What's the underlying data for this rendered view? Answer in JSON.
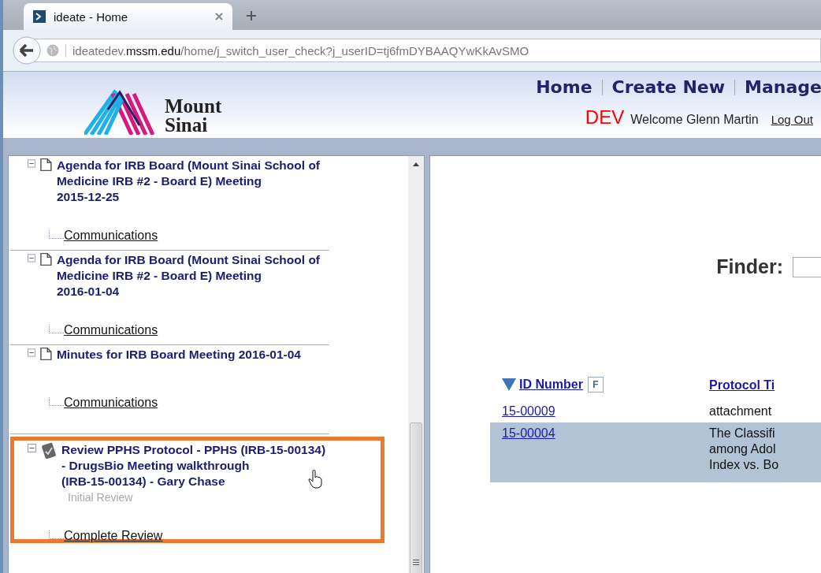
{
  "browser": {
    "tab": {
      "title": "ideate - Home",
      "selected": true
    },
    "url": {
      "prefix": "ideatedev.",
      "host": "mssm.edu",
      "path": "/home/j_switch_user_check?j_userID=tj6fmDYBAAQYwKkAvSMO"
    }
  },
  "header": {
    "logo": {
      "line1": "Mount",
      "line2": "Sinai"
    },
    "nav": [
      {
        "label": "Home"
      },
      {
        "label": "Create New"
      },
      {
        "label": "Manage"
      }
    ],
    "environment": "DEV",
    "welcome": "Welcome Glenn Martin",
    "logout": "Log Out"
  },
  "tree": [
    {
      "kind": "document",
      "title": [
        "Agenda for IRB Board (Mount Sinai School of",
        "Medicine IRB #2 - Board E) Meeting",
        "2015-12-25"
      ],
      "expanded": true,
      "highlighted": false,
      "children": [
        {
          "label": "Communications"
        }
      ]
    },
    {
      "kind": "document",
      "title": [
        "Agenda for IRB Board (Mount Sinai School of",
        "Medicine IRB #2 - Board E) Meeting",
        "2016-01-04"
      ],
      "expanded": true,
      "highlighted": false,
      "children": [
        {
          "label": "Communications"
        }
      ]
    },
    {
      "kind": "document",
      "title": [
        "Minutes for IRB Board Meeting 2016-01-04"
      ],
      "expanded": true,
      "highlighted": false,
      "children": [
        {
          "label": "Communications"
        }
      ]
    },
    {
      "kind": "task",
      "title": [
        "Review PPHS Protocol - PPHS (IRB-15-00134)",
        "- DrugsBio Meeting walkthrough",
        "(IRB-15-00134) - Gary Chase"
      ],
      "status": "Initial Review",
      "expanded": true,
      "highlighted": true,
      "children": [
        {
          "label": "Complete Review"
        }
      ]
    }
  ],
  "finder": {
    "label": "Finder:"
  },
  "table": {
    "columns": [
      {
        "label": "ID Number",
        "sorted": true,
        "filter": "F"
      },
      {
        "label": "Protocol Ti"
      }
    ],
    "rows": [
      {
        "id": "15-00009",
        "title": [
          "attachment"
        ],
        "selected": false
      },
      {
        "id": "15-00004",
        "title": [
          "The Classifi",
          "among Adol",
          "Index vs. Bo"
        ],
        "selected": true
      }
    ]
  }
}
